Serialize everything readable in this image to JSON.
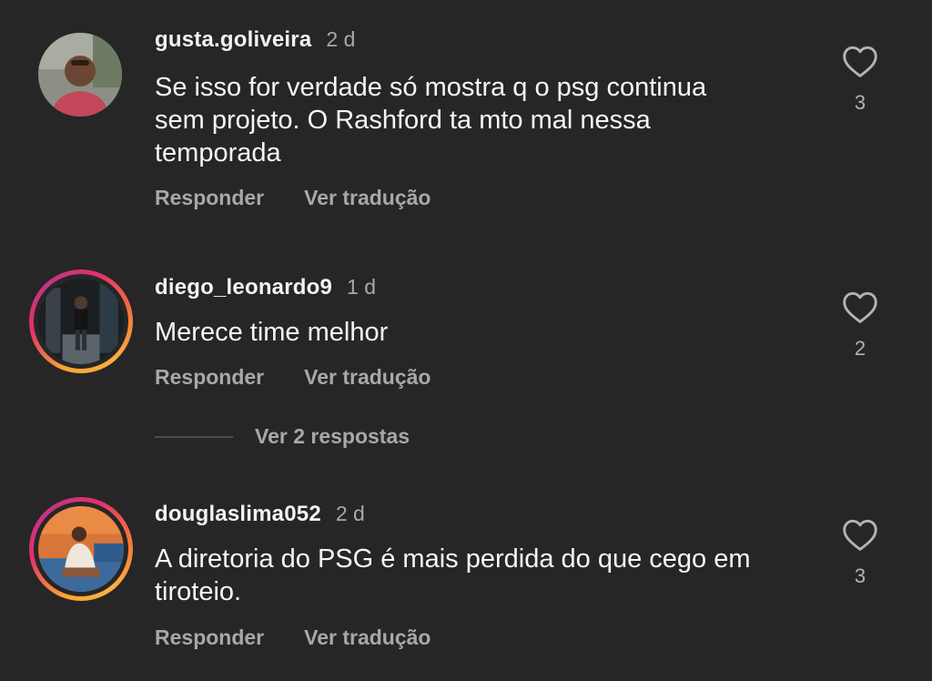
{
  "comments": [
    {
      "username": "gusta.goliveira",
      "time": "2 d",
      "lines": [
        "Se isso for verdade só mostra q o psg continua",
        "sem projeto. O Rashford ta mto  mal nessa",
        "temporada"
      ],
      "reply_label": "Responder",
      "translate_label": "Ver tradução",
      "likes": "3",
      "has_story_ring": false
    },
    {
      "username": "diego_leonardo9",
      "time": "1 d",
      "lines": [
        "Merece time melhor"
      ],
      "reply_label": "Responder",
      "translate_label": "Ver tradução",
      "likes": "2",
      "has_story_ring": true,
      "view_replies_label": "Ver 2 respostas"
    },
    {
      "username": "douglaslima052",
      "time": "2 d",
      "lines": [
        "A diretoria do PSG é mais perdida do que cego em",
        "tiroteio."
      ],
      "reply_label": "Responder",
      "translate_label": "Ver tradução",
      "likes": "3",
      "has_story_ring": true
    }
  ],
  "icons": {
    "like": "heart-outline-icon"
  },
  "colors": {
    "background": "#262626",
    "text": "#f5f5f5",
    "secondary": "#a8a8a8"
  }
}
